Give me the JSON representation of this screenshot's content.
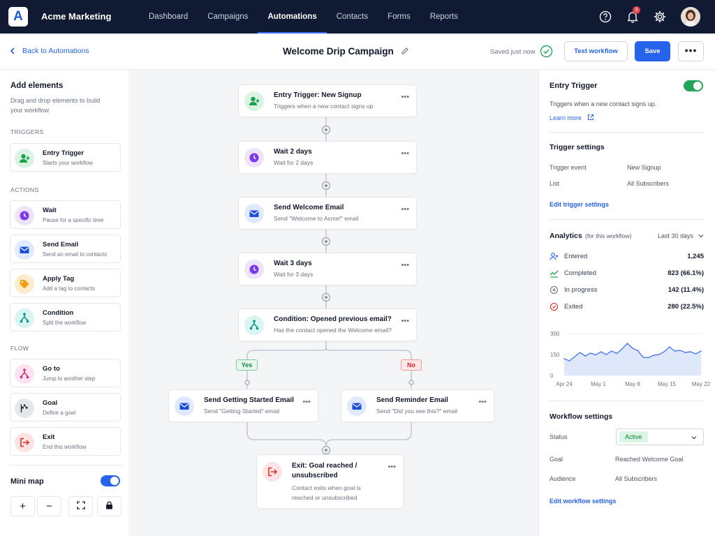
{
  "app": {
    "logo_letter": "A",
    "brand": "Acme Marketing",
    "notification_count": "3"
  },
  "nav": [
    {
      "label": "Dashboard"
    },
    {
      "label": "Campaigns"
    },
    {
      "label": "Automations",
      "active": true
    },
    {
      "label": "Contacts"
    },
    {
      "label": "Forms"
    },
    {
      "label": "Reports"
    }
  ],
  "subbar": {
    "back_label": "Back to Automations",
    "title": "Welcome Drip Campaign",
    "saved_label": "Saved just now",
    "test_label": "Test workflow",
    "save_label": "Save",
    "more_label": "•••"
  },
  "left_panel": {
    "title": "Add elements",
    "description": "Drag and drop elements to build your workflow.",
    "sections": [
      {
        "label": "TRIGGERS",
        "items": [
          {
            "title": "Entry Trigger",
            "subtitle": "Starts your workflow",
            "icon": "user-plus-icon"
          }
        ]
      },
      {
        "label": "ACTIONS",
        "items": [
          {
            "title": "Wait",
            "subtitle": "Pause for a specific time",
            "icon": "clock-icon"
          },
          {
            "title": "Send Email",
            "subtitle": "Send an email to contacts",
            "icon": "mail-icon"
          },
          {
            "title": "Apply Tag",
            "subtitle": "Add a tag to contacts",
            "icon": "tag-icon"
          },
          {
            "title": "Condition",
            "subtitle": "Split the workflow",
            "icon": "split-icon"
          }
        ]
      },
      {
        "label": "FLOW",
        "items": [
          {
            "title": "Go to",
            "subtitle": "Jump to another step",
            "icon": "goto-icon"
          },
          {
            "title": "Goal",
            "subtitle": "Define a goal",
            "icon": "flag-icon"
          },
          {
            "title": "Exit",
            "subtitle": "End this workflow",
            "icon": "exit-icon"
          }
        ]
      }
    ],
    "minimap_label": "Mini map",
    "minimap_on": true,
    "zoom_in": "+",
    "zoom_out": "−"
  },
  "workflow": {
    "nodes": [
      {
        "title": "Entry Trigger: New Signup",
        "subtitle": "Triggers when a new contact signs up",
        "icon": "user-plus-icon"
      },
      {
        "title": "Wait 2 days",
        "subtitle": "Wait for 2 days",
        "icon": "clock-icon"
      },
      {
        "title": "Send Welcome Email",
        "subtitle": "Send \"Welcome to Acme!\" email",
        "icon": "mail-icon"
      },
      {
        "title": "Wait 3 days",
        "subtitle": "Wait for 3 days",
        "icon": "clock-icon"
      },
      {
        "title": "Condition: Opened previous email?",
        "subtitle": "Has the contact opened the Welcome email?",
        "icon": "split-icon"
      },
      {
        "title": "Send Getting Started Email",
        "subtitle": "Send \"Getting Started\" email",
        "icon": "mail-icon"
      },
      {
        "title": "Send Reminder Email",
        "subtitle": "Send \"Did you see this?\" email",
        "icon": "mail-icon"
      },
      {
        "title": "Exit: Goal reached /",
        "title2": "unsubscribed",
        "subtitle": "Contact exits when goal is",
        "subtitle2": "reached or unsubscribed",
        "icon": "exit-icon"
      }
    ],
    "yes_label": "Yes",
    "no_label": "No",
    "node_menu": "•••"
  },
  "right_panel": {
    "trigger_title": "Entry Trigger",
    "trigger_enabled": true,
    "trigger_desc": "Triggers when a new contact signs up.",
    "learn_more": "Learn more",
    "trigger_settings_title": "Trigger settings",
    "trigger_event_label": "Trigger event",
    "trigger_event_value": "New Signup",
    "list_label": "List",
    "list_value": "All Subscribers",
    "edit_trigger": "Edit trigger settings",
    "analytics_title": "Analytics",
    "analytics_sub": "(for this workflow)",
    "range": "Last 30 days",
    "stats": [
      {
        "label": "Entered",
        "value": "1,245",
        "icon": "user-plus-icon",
        "color": "#2563eb"
      },
      {
        "label": "Completed",
        "value": "823 (66.1%)",
        "icon": "trend-icon",
        "color": "#16a34a"
      },
      {
        "label": "In progress",
        "value": "142 (11.4%)",
        "icon": "progress-icon",
        "color": "#6b7280"
      },
      {
        "label": "Exited",
        "value": "280 (22.5%)",
        "icon": "x-circle-icon",
        "color": "#dc2626"
      }
    ],
    "workflow_settings_title": "Workflow settings",
    "status_label": "Status",
    "status_value": "Active",
    "goal_label": "Goal",
    "goal_value": "Reached Welcome Goal",
    "audience_label": "Audience",
    "audience_value": "All Subscribers",
    "edit_workflow": "Edit workflow settings"
  },
  "chart_data": {
    "type": "area",
    "xlabels": [
      "Apr 24",
      "May 1",
      "May 8",
      "May 15",
      "May 22"
    ],
    "yticks": [
      "300",
      "150",
      "0"
    ],
    "ylim": [
      0,
      300
    ],
    "values": [
      120,
      105,
      135,
      165,
      140,
      160,
      148,
      170,
      150,
      175,
      158,
      190,
      230,
      195,
      178,
      130,
      128,
      145,
      150,
      170,
      205,
      175,
      180,
      165,
      170,
      155,
      175
    ],
    "color": "#4a7df0"
  }
}
